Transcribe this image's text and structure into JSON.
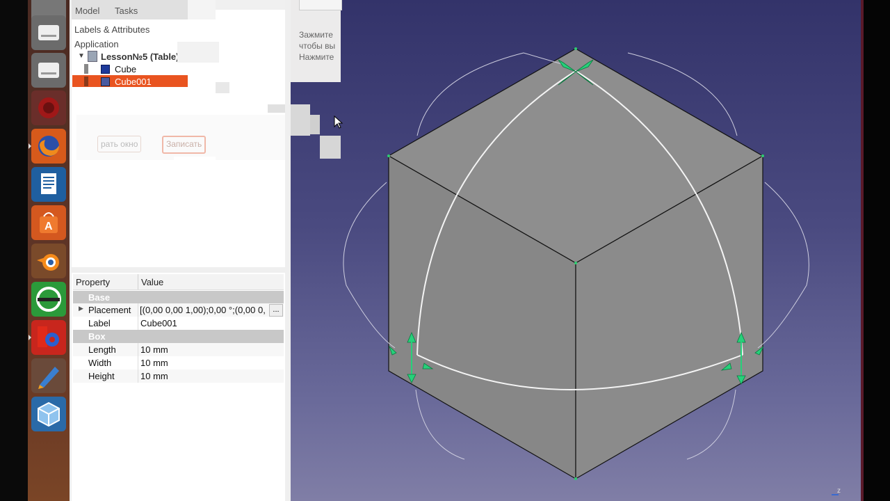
{
  "launcher": {
    "items": [
      {
        "name": "disk-icon"
      },
      {
        "name": "disk-icon"
      },
      {
        "name": "disk-icon"
      },
      {
        "name": "red-app-icon"
      },
      {
        "name": "firefox-icon"
      },
      {
        "name": "writer-icon"
      },
      {
        "name": "software-center-icon"
      },
      {
        "name": "blender-icon"
      },
      {
        "name": "green-app-icon"
      },
      {
        "name": "freecad-icon"
      },
      {
        "name": "tool-icon"
      },
      {
        "name": "virtualbox-icon"
      }
    ]
  },
  "tabs": {
    "model": "Model",
    "tasks": "Tasks"
  },
  "labels_attributes": "Labels & Attributes",
  "application": "Application",
  "tree": {
    "root": "Lesson№5 (Table)",
    "items": [
      "Cube",
      "Cube001"
    ]
  },
  "dialog": {
    "close": "рать окно",
    "record": "Записать"
  },
  "hint": {
    "line1": "Зажмите",
    "line2": "чтобы вы",
    "line3": "Нажмите"
  },
  "properties": {
    "header": {
      "property": "Property",
      "value": "Value"
    },
    "groups": {
      "base": "Base",
      "box": "Box"
    },
    "rows": {
      "placement": {
        "name": "Placement",
        "value": "[(0,00 0,00 1,00);0,00 °;(0,00 0,"
      },
      "label": {
        "name": "Label",
        "value": "Cube001"
      },
      "length": {
        "name": "Length",
        "value": "10 mm"
      },
      "width": {
        "name": "Width",
        "value": "10 mm"
      },
      "height": {
        "name": "Height",
        "value": "10 mm"
      }
    },
    "ellipsis": "..."
  },
  "axis_label": "z",
  "colors": {
    "selection": "#e95420",
    "viewport_top": "#33336a",
    "viewport_bottom": "#807ea6",
    "cube_face": "#8a8a8a",
    "dragger": "#2ecc71"
  }
}
